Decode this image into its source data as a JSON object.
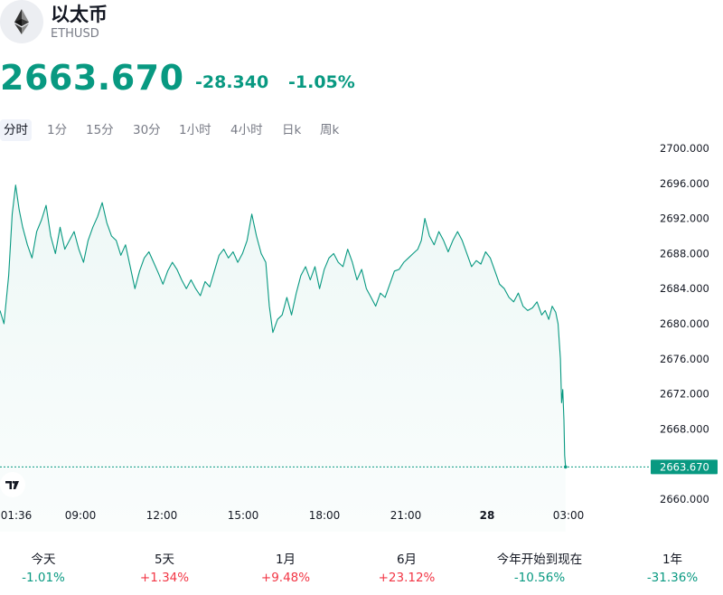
{
  "header": {
    "title": "以太币",
    "ticker": "ETHUSD",
    "logo_icon": "ethereum-icon"
  },
  "quote": {
    "price": "2663.670",
    "change": "-28.340",
    "change_pct": "-1.05%",
    "color": "#089981"
  },
  "intervals": [
    {
      "label": "分时",
      "active": true
    },
    {
      "label": "1分",
      "active": false
    },
    {
      "label": "15分",
      "active": false
    },
    {
      "label": "30分",
      "active": false
    },
    {
      "label": "1小时",
      "active": false
    },
    {
      "label": "4小时",
      "active": false
    },
    {
      "label": "日k",
      "active": false
    },
    {
      "label": "周k",
      "active": false
    }
  ],
  "chart_data": {
    "type": "area",
    "ylim": [
      2658,
      2700
    ],
    "y_ticks": [
      "2660.000",
      "2664.000",
      "2668.000",
      "2672.000",
      "2676.000",
      "2680.000",
      "2684.000",
      "2688.000",
      "2692.000",
      "2696.000",
      "2700.000"
    ],
    "x_ticks": [
      {
        "label": "01:36",
        "hour": 1.6,
        "bold": false
      },
      {
        "label": "09:00",
        "hour": 9,
        "bold": false
      },
      {
        "label": "12:00",
        "hour": 12,
        "bold": false
      },
      {
        "label": "15:00",
        "hour": 15,
        "bold": false
      },
      {
        "label": "18:00",
        "hour": 18,
        "bold": false
      },
      {
        "label": "21:00",
        "hour": 21,
        "bold": false
      },
      {
        "label": "28",
        "hour": 24,
        "bold": true
      },
      {
        "label": "03:00",
        "hour": 27,
        "bold": false
      }
    ],
    "x_range_hours": [
      6.03,
      32.47
    ],
    "series": [
      {
        "values": [
          [
            6.03,
            2681.5
          ],
          [
            6.2,
            2680.0
          ],
          [
            6.4,
            2685.5
          ],
          [
            6.55,
            2692.5
          ],
          [
            6.7,
            2695.8
          ],
          [
            6.85,
            2693.0
          ],
          [
            7.0,
            2691.0
          ],
          [
            7.2,
            2689.0
          ],
          [
            7.4,
            2687.5
          ],
          [
            7.6,
            2690.5
          ],
          [
            7.8,
            2691.8
          ],
          [
            8.0,
            2693.5
          ],
          [
            8.2,
            2690.0
          ],
          [
            8.4,
            2688.0
          ],
          [
            8.6,
            2691.0
          ],
          [
            8.8,
            2688.5
          ],
          [
            9.0,
            2689.5
          ],
          [
            9.2,
            2690.5
          ],
          [
            9.4,
            2688.5
          ],
          [
            9.6,
            2687.0
          ],
          [
            9.8,
            2689.5
          ],
          [
            10.0,
            2691.0
          ],
          [
            10.2,
            2692.2
          ],
          [
            10.4,
            2693.8
          ],
          [
            10.6,
            2691.5
          ],
          [
            10.8,
            2690.0
          ],
          [
            11.0,
            2689.5
          ],
          [
            11.2,
            2687.8
          ],
          [
            11.4,
            2689.0
          ],
          [
            11.6,
            2686.5
          ],
          [
            11.8,
            2684.0
          ],
          [
            12.0,
            2686.0
          ],
          [
            12.2,
            2687.5
          ],
          [
            12.4,
            2688.2
          ],
          [
            12.6,
            2687.0
          ],
          [
            12.8,
            2685.8
          ],
          [
            13.0,
            2684.5
          ],
          [
            13.2,
            2686.0
          ],
          [
            13.4,
            2687.0
          ],
          [
            13.6,
            2686.2
          ],
          [
            13.8,
            2685.0
          ],
          [
            14.0,
            2684.0
          ],
          [
            14.2,
            2685.0
          ],
          [
            14.4,
            2684.0
          ],
          [
            14.6,
            2683.2
          ],
          [
            14.8,
            2684.8
          ],
          [
            15.0,
            2684.2
          ],
          [
            15.2,
            2686.0
          ],
          [
            15.4,
            2687.8
          ],
          [
            15.6,
            2688.5
          ],
          [
            15.8,
            2687.5
          ],
          [
            16.0,
            2688.2
          ],
          [
            16.2,
            2687.0
          ],
          [
            16.4,
            2688.0
          ],
          [
            16.6,
            2689.5
          ],
          [
            16.8,
            2692.5
          ],
          [
            17.0,
            2690.0
          ],
          [
            17.2,
            2688.0
          ],
          [
            17.4,
            2687.0
          ],
          [
            17.55,
            2682.0
          ],
          [
            17.7,
            2679.0
          ],
          [
            17.9,
            2680.5
          ],
          [
            18.1,
            2681.0
          ],
          [
            18.3,
            2683.0
          ],
          [
            18.5,
            2681.0
          ],
          [
            18.7,
            2683.5
          ],
          [
            18.9,
            2685.5
          ],
          [
            19.1,
            2686.5
          ],
          [
            19.3,
            2685.0
          ],
          [
            19.5,
            2686.5
          ],
          [
            19.7,
            2684.0
          ],
          [
            19.9,
            2686.2
          ],
          [
            20.1,
            2687.5
          ],
          [
            20.3,
            2688.0
          ],
          [
            20.5,
            2687.0
          ],
          [
            20.7,
            2686.5
          ],
          [
            20.9,
            2688.5
          ],
          [
            21.1,
            2687.0
          ],
          [
            21.3,
            2685.0
          ],
          [
            21.5,
            2686.2
          ],
          [
            21.7,
            2684.0
          ],
          [
            21.9,
            2683.0
          ],
          [
            22.1,
            2682.0
          ],
          [
            22.3,
            2683.5
          ],
          [
            22.5,
            2683.0
          ],
          [
            22.7,
            2684.5
          ],
          [
            22.9,
            2686.0
          ],
          [
            23.1,
            2686.2
          ],
          [
            23.3,
            2687.0
          ],
          [
            23.5,
            2687.5
          ],
          [
            23.7,
            2688.0
          ],
          [
            23.9,
            2688.5
          ],
          [
            24.05,
            2689.5
          ],
          [
            24.2,
            2692.0
          ],
          [
            24.4,
            2690.0
          ],
          [
            24.6,
            2689.0
          ],
          [
            24.8,
            2690.5
          ],
          [
            25.0,
            2689.5
          ],
          [
            25.2,
            2688.2
          ],
          [
            25.4,
            2689.5
          ],
          [
            25.6,
            2690.5
          ],
          [
            25.8,
            2689.5
          ],
          [
            26.0,
            2688.0
          ],
          [
            26.2,
            2686.5
          ],
          [
            26.4,
            2687.2
          ],
          [
            26.6,
            2686.8
          ],
          [
            26.8,
            2688.2
          ],
          [
            27.0,
            2687.5
          ],
          [
            27.2,
            2686.0
          ],
          [
            27.4,
            2684.5
          ],
          [
            27.6,
            2684.0
          ],
          [
            27.8,
            2683.0
          ],
          [
            28.0,
            2682.5
          ],
          [
            28.2,
            2683.5
          ],
          [
            28.4,
            2682.0
          ],
          [
            28.6,
            2681.5
          ],
          [
            28.8,
            2681.8
          ],
          [
            29.0,
            2682.5
          ],
          [
            29.2,
            2681.0
          ],
          [
            29.35,
            2681.5
          ],
          [
            29.5,
            2680.5
          ],
          [
            29.65,
            2682.0
          ],
          [
            29.8,
            2681.3
          ],
          [
            29.9,
            2680.0
          ],
          [
            30.0,
            2676.0
          ],
          [
            30.05,
            2671.0
          ],
          [
            30.1,
            2672.5
          ],
          [
            30.15,
            2669.0
          ],
          [
            30.18,
            2665.0
          ],
          [
            30.22,
            2663.67
          ]
        ]
      }
    ],
    "last_value": "2663.670",
    "line_color": "#089981",
    "grid": false
  },
  "watermark_icon": "tradingview-logo-icon",
  "performance": [
    {
      "label": "今天",
      "value": "-1.01%",
      "direction": "neg"
    },
    {
      "label": "5天",
      "value": "+1.34%",
      "direction": "pos"
    },
    {
      "label": "1月",
      "value": "+9.48%",
      "direction": "pos"
    },
    {
      "label": "6月",
      "value": "+23.12%",
      "direction": "pos"
    },
    {
      "label": "今年开始到现在",
      "value": "-10.56%",
      "direction": "neg"
    },
    {
      "label": "1年",
      "value": "-31.36%",
      "direction": "neg"
    }
  ]
}
